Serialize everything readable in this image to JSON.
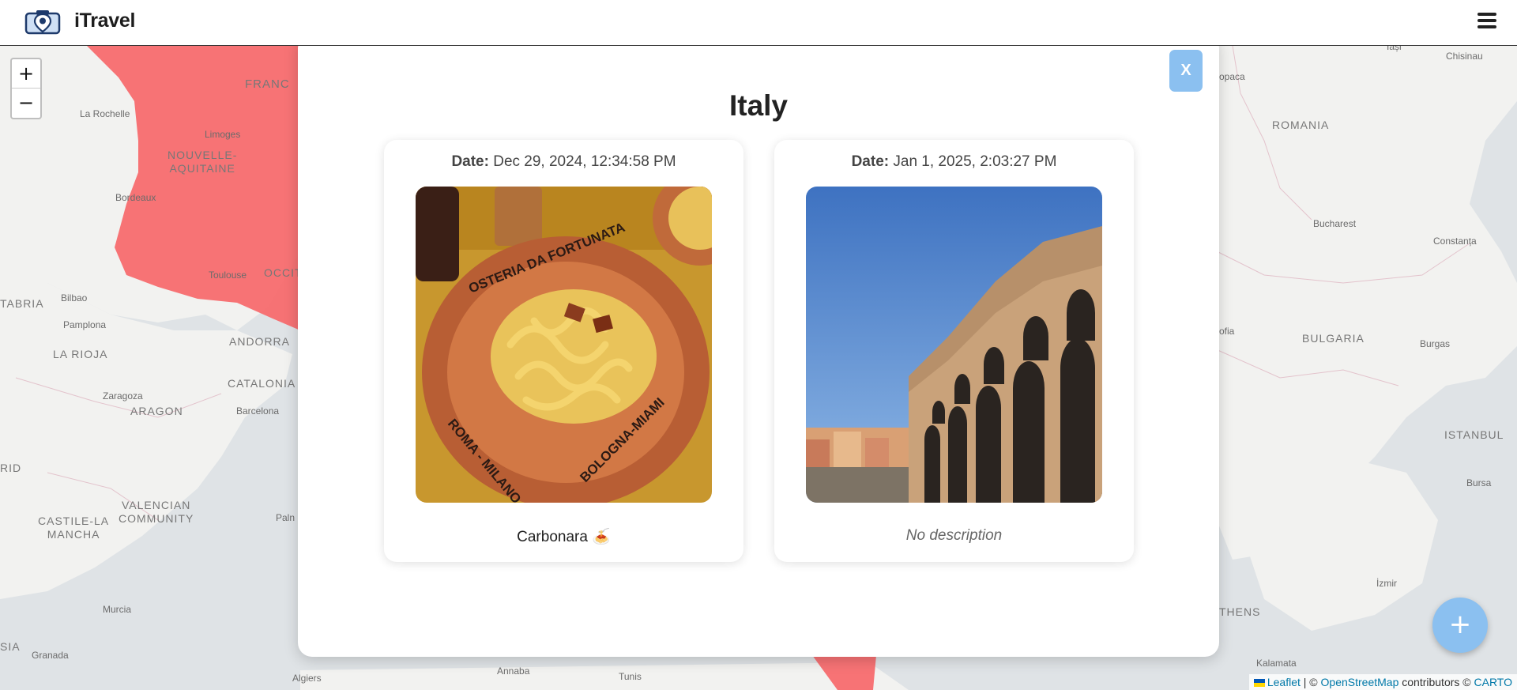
{
  "header": {
    "app_title": "iTravel",
    "logo_icon": "camera-location-icon",
    "menu_icon": "hamburger-menu-icon"
  },
  "map": {
    "zoom_in_label": "+",
    "zoom_out_label": "−",
    "add_button_label": "+",
    "highlight_color": "#f76b6e",
    "labels": {
      "france": "FRANC",
      "la_rochelle": "La Rochelle",
      "limoges": "Limoges",
      "nouvelle_aquitaine": "NOUVELLE-\nAQUITAINE",
      "bordeaux": "Bordeaux",
      "toulouse": "Toulouse",
      "occitanie": "OCCIT",
      "tabria": "TABRIA",
      "bilbao": "Bilbao",
      "pamplona": "Pamplona",
      "andorra": "ANDORRA",
      "la_rioja": "LA RIOJA",
      "catalonia": "CATALONIA",
      "zaragoza": "Zaragoza",
      "aragon": "ARAGON",
      "barcelona": "Barcelona",
      "madrid": "RID",
      "castile": "CASTILE-LA\nMANCHA",
      "valencian": "VALENCIAN\nCOMMUNITY",
      "palma": "Paln",
      "murcia": "Murcia",
      "granada": "Granada",
      "andalusia": "SIA",
      "algiers": "Algiers",
      "annaba": "Annaba",
      "tunis": "Tunis",
      "iasi": "Iași",
      "chisinau": "Chisinau",
      "opaca": "opaca",
      "romania": "ROMANIA",
      "bucharest": "Bucharest",
      "constanta": "Constanța",
      "sofia": "ofia",
      "bulgaria": "BULGARIA",
      "burgas": "Burgas",
      "istanbul": "ISTANBUL",
      "bursa": "Bursa",
      "izmir": "İzmir",
      "athens": "THENS",
      "kalamata": "Kalamata"
    },
    "attribution": {
      "leaflet": "Leaflet",
      "sep1": " | © ",
      "osm": "OpenStreetMap",
      "contributors": " contributors © ",
      "carto": "CARTO"
    }
  },
  "modal": {
    "close_label": "X",
    "title": "Italy",
    "cards": [
      {
        "date_label": "Date:",
        "date_value": " Dec 29, 2024, 12:34:58 PM",
        "photo_icon": "pasta-carbonara-photo",
        "description": "Carbonara 🍝"
      },
      {
        "date_label": "Date:",
        "date_value": " Jan 1, 2025, 2:03:27 PM",
        "photo_icon": "verona-arena-photo",
        "description": "No description"
      }
    ]
  }
}
